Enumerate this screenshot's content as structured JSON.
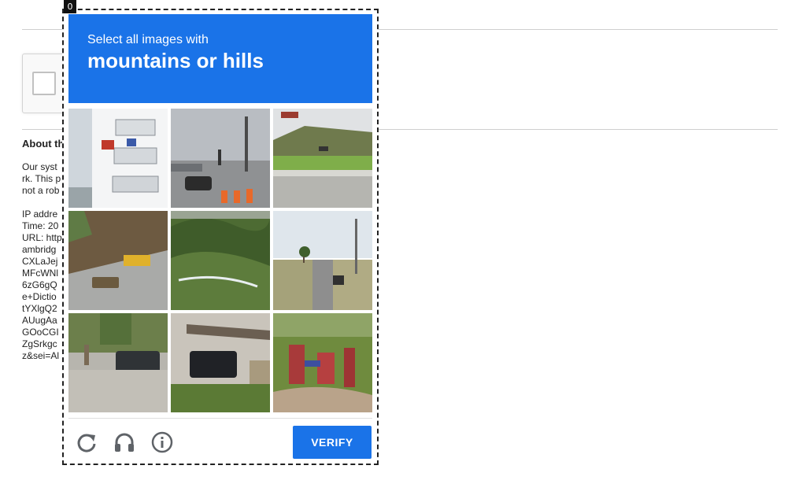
{
  "page": {
    "about_title": "About th",
    "lines": [
      "Our syst",
      "rk. This p",
      "not a rob",
      "",
      "IP addre",
      "Time: 20",
      "URL: http",
      "ambridg",
      "CXLaJej",
      "MFcWNl",
      "6zG6gQ",
      "e+Dictio",
      "tYXlgQ2",
      "AUugAa",
      "GOoCGI",
      "ZgSrkgc",
      "z&sei=Al"
    ]
  },
  "challenge": {
    "badge": "0",
    "instruction": "Select all images with",
    "target": "mountains or hills",
    "tiles": [
      {
        "id": "tile-1",
        "subject": "apartment balconies"
      },
      {
        "id": "tile-2",
        "subject": "intersection with cones"
      },
      {
        "id": "tile-3",
        "subject": "highway with grass hill"
      },
      {
        "id": "tile-4",
        "subject": "road by hillside with bus"
      },
      {
        "id": "tile-5",
        "subject": "green hills valley"
      },
      {
        "id": "tile-6",
        "subject": "road with palm trees"
      },
      {
        "id": "tile-7",
        "subject": "parked cars and trees"
      },
      {
        "id": "tile-8",
        "subject": "car under carport"
      },
      {
        "id": "tile-9",
        "subject": "fire hydrant pipes"
      }
    ],
    "verify_label": "VERIFY",
    "icons": [
      "reload-icon",
      "audio-icon",
      "info-icon"
    ],
    "accent_color": "#1a73e8"
  }
}
